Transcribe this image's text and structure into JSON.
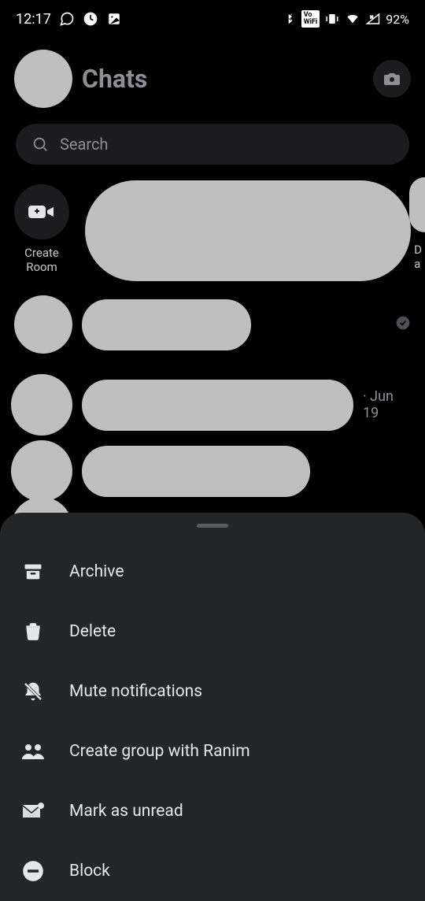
{
  "status": {
    "time": "12:17",
    "battery": "92%"
  },
  "header": {
    "title": "Chats"
  },
  "search": {
    "placeholder": "Search"
  },
  "createRoom": {
    "line1": "Create",
    "line2": "Room"
  },
  "partialLetter1": "D",
  "partialLetter2": "a",
  "chatDate": "· Jun 19",
  "sheet": {
    "archive": "Archive",
    "delete": "Delete",
    "mute": "Mute notifications",
    "createGroup": "Create group with Ranim",
    "markUnread": "Mark as unread",
    "block": "Block"
  }
}
